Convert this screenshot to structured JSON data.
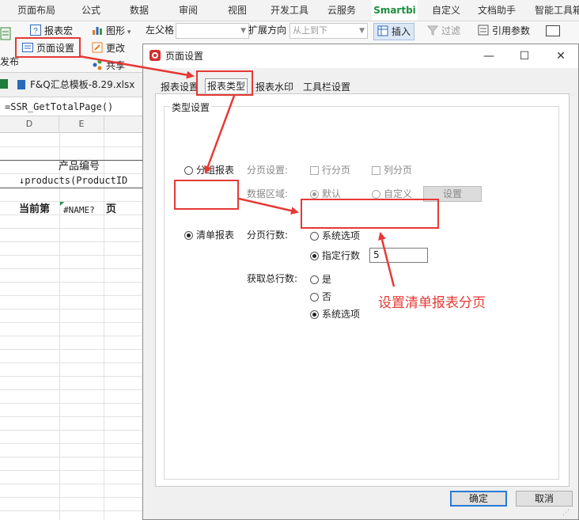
{
  "ribbon_tabs": [
    "页面布局",
    "公式",
    "数据",
    "审阅",
    "视图",
    "开发工具",
    "云服务",
    "Smartbi",
    "自定义",
    "文档助手",
    "智能工具箱"
  ],
  "ribbon": {
    "report_macro": "报表宏",
    "page_setup": "页面设置",
    "publish_label": "发布",
    "chart": "图形",
    "update": "更改",
    "share": "共享",
    "left_parent": "左父格",
    "expand_direction": "扩展方向",
    "expand_value": "从上到下",
    "insert": "插入",
    "filter": "过滤",
    "ref_param": "引用参数"
  },
  "file_tab": "F&Q汇总模板-8.29.xlsx",
  "formula": "=SSR_GetTotalPage()",
  "sheet": {
    "col_d": "D",
    "col_e": "E",
    "header_cell": "产品编号",
    "data_cell": "↓products(ProductID",
    "page_label": "当前第",
    "name_error": "#NAME?",
    "page_suffix": "页"
  },
  "dialog": {
    "title": "页面设置",
    "tabs": [
      "报表设置",
      "报表类型",
      "报表水印",
      "工具栏设置"
    ],
    "group_title": "类型设置",
    "group_report": "分组报表",
    "paging_setting": "分页设置:",
    "row_paging": "行分页",
    "col_paging": "列分页",
    "data_area": "数据区域:",
    "default": "默认",
    "custom": "自定义",
    "settings_btn": "设置",
    "list_report": "清单报表",
    "paging_rows": "分页行数:",
    "system_option": "系统选项",
    "specify_rows": "指定行数",
    "rows_value": "5",
    "get_total": "获取总行数:",
    "yes": "是",
    "no": "否",
    "system_option2": "系统选项",
    "ok": "确定",
    "cancel": "取消"
  },
  "annotation": "设置清单报表分页",
  "colors": {
    "annotation_red": "#e53935",
    "accent_blue": "#2a7ad4",
    "smartbi_green": "#1e8e3e"
  }
}
